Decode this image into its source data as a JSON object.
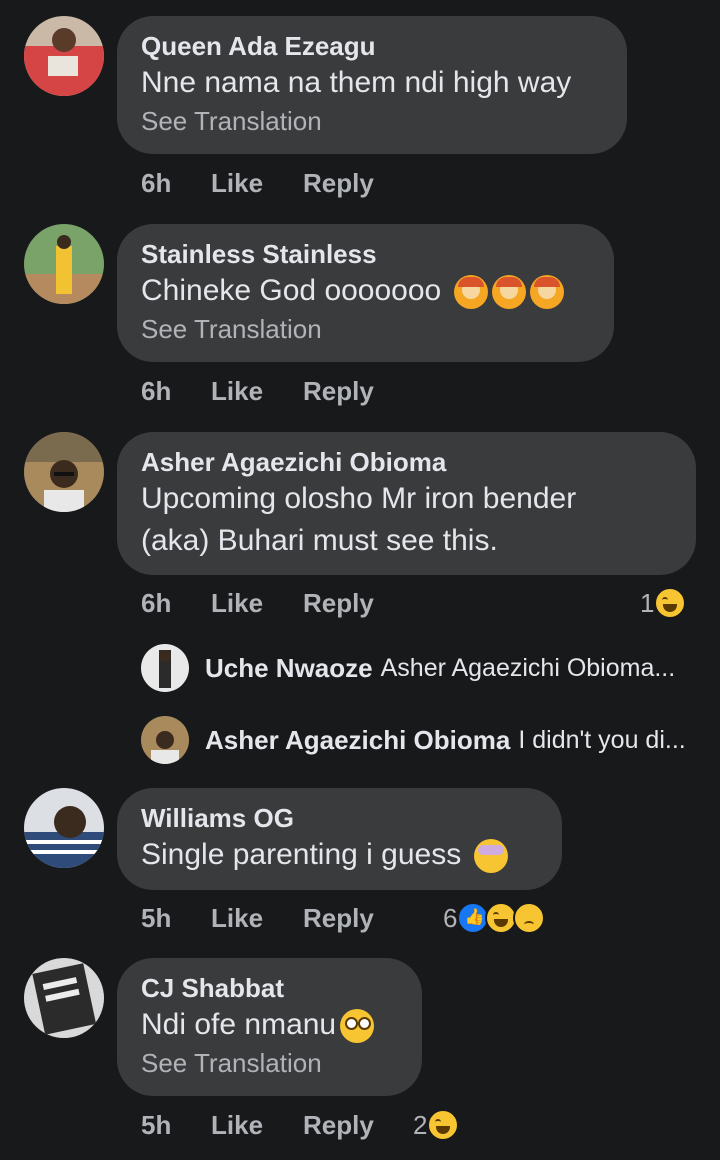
{
  "comments": [
    {
      "name": "Queen Ada Ezeagu",
      "text": "Nne nama na them ndi high way",
      "see_translation": "See Translation",
      "time": "6h",
      "like": "Like",
      "reply": "Reply"
    },
    {
      "name": "Stainless Stainless",
      "text": "Chineke God ooooooo",
      "emoji": [
        "woman-gesturing-icon",
        "woman-gesturing-icon",
        "woman-gesturing-icon"
      ],
      "see_translation": "See Translation",
      "time": "6h",
      "like": "Like",
      "reply": "Reply"
    },
    {
      "name": "Asher Agaezichi Obioma",
      "text_line1": "Upcoming olosho Mr iron bender",
      "text_line2": "(aka) Buhari must see this.",
      "time": "6h",
      "like": "Like",
      "reply": "Reply",
      "reaction_count": "1",
      "reactions": [
        "haha-icon"
      ],
      "replies": [
        {
          "name": "Uche Nwaoze",
          "text": "Asher Agaezichi Obioma..."
        },
        {
          "name": "Asher Agaezichi Obioma",
          "text": "I didn't you di..."
        }
      ]
    },
    {
      "name": "Williams OG",
      "text": "Single parenting i guess",
      "emoji": [
        "dizzy-face-icon"
      ],
      "time": "5h",
      "like": "Like",
      "reply": "Reply",
      "reaction_count": "6",
      "reactions": [
        "like-icon",
        "haha-icon",
        "sad-icon"
      ]
    },
    {
      "name": "CJ Shabbat",
      "text": "Ndi ofe nmanu",
      "emoji": [
        "eye-roll-icon"
      ],
      "see_translation": "See Translation",
      "time": "5h",
      "like": "Like",
      "reply": "Reply",
      "reaction_count": "2",
      "reactions": [
        "haha-icon"
      ]
    }
  ],
  "colors": {
    "background": "#18191a",
    "bubble": "#3a3b3c",
    "text": "#e4e6eb",
    "muted": "#b0b3b8",
    "like_blue": "#1877f2",
    "haha_yellow": "#f7c531"
  }
}
